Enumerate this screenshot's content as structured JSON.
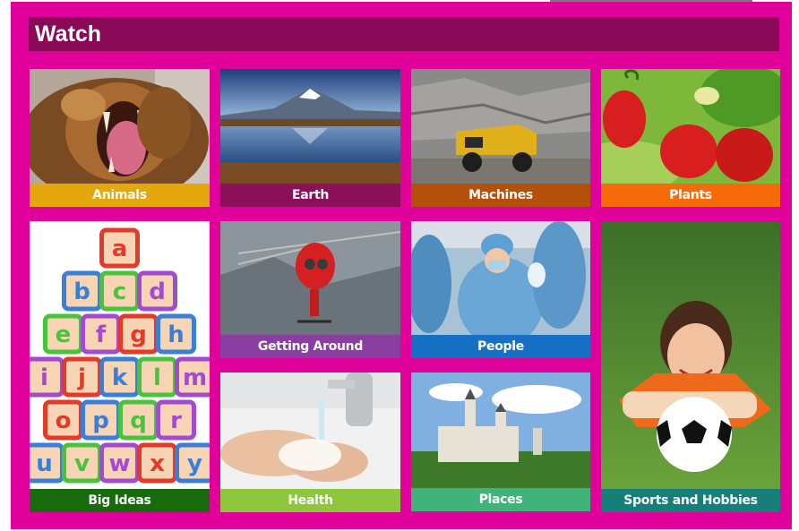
{
  "page": {
    "title": "Watch"
  },
  "tiles": [
    {
      "label": "Animals",
      "color": "#e4a80c",
      "image": "lion-image"
    },
    {
      "label": "Earth",
      "color": "#8c1059",
      "image": "mountain-lake-image"
    },
    {
      "label": "Machines",
      "color": "#b4500a",
      "image": "mining-truck-image"
    },
    {
      "label": "Plants",
      "color": "#f76a0a",
      "image": "strawberries-image"
    },
    {
      "label": "Big Ideas",
      "color": "#176b0c",
      "image": "alphabet-blocks-image"
    },
    {
      "label": "Getting Around",
      "color": "#8a3ea2",
      "image": "helicopter-image"
    },
    {
      "label": "People",
      "color": "#1670c4",
      "image": "surgeons-image"
    },
    {
      "label": "Sports and Hobbies",
      "color": "#167f7a",
      "image": "girl-with-football-image"
    },
    {
      "label": "Health",
      "color": "#8ec63c",
      "image": "hand-washing-image"
    },
    {
      "label": "Places",
      "color": "#3fb37a",
      "image": "castle-image"
    }
  ],
  "blocks": {
    "row1": [
      "a"
    ],
    "row2": [
      "b",
      "c",
      "d"
    ],
    "row3": [
      "e",
      "f",
      "g",
      "h"
    ],
    "row4": [
      "i",
      "j",
      "k",
      "l",
      "m"
    ],
    "row5": [
      "o",
      "p",
      "q",
      "r"
    ],
    "row6": [
      "u",
      "v",
      "w",
      "x",
      "y"
    ]
  }
}
